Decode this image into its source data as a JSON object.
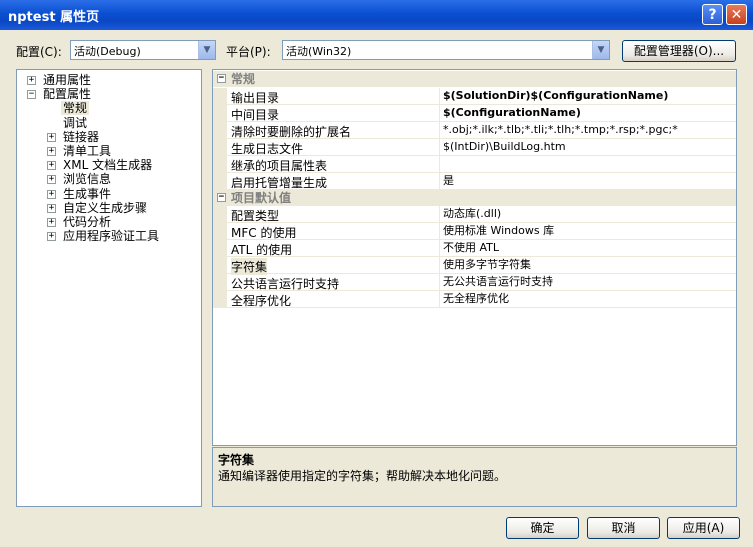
{
  "window": {
    "title": "nptest 属性页",
    "help_label": "?",
    "close_label": "✕"
  },
  "toolbar": {
    "config_label": "配置(C):",
    "config_value": "活动(Debug)",
    "platform_label": "平台(P):",
    "platform_value": "活动(Win32)",
    "config_manager_label": "配置管理器(O)..."
  },
  "tree": {
    "items": [
      {
        "label": "通用属性",
        "exp": "+"
      },
      {
        "label": "配置属性",
        "exp": "−"
      },
      {
        "label": "常规",
        "exp": ""
      },
      {
        "label": "调试",
        "exp": ""
      },
      {
        "label": "链接器",
        "exp": "+"
      },
      {
        "label": "清单工具",
        "exp": "+"
      },
      {
        "label": "XML 文档生成器",
        "exp": "+"
      },
      {
        "label": "浏览信息",
        "exp": "+"
      },
      {
        "label": "生成事件",
        "exp": "+"
      },
      {
        "label": "自定义生成步骤",
        "exp": "+"
      },
      {
        "label": "代码分析",
        "exp": "+"
      },
      {
        "label": "应用程序验证工具",
        "exp": "+"
      }
    ],
    "selected": "常规"
  },
  "grid": {
    "categories": [
      {
        "name": "常规",
        "exp": "−",
        "rows": [
          {
            "name": "输出目录",
            "value": "$(SolutionDir)$(ConfigurationName)",
            "bold": true
          },
          {
            "name": "中间目录",
            "value": "$(ConfigurationName)",
            "bold": true
          },
          {
            "name": "清除时要删除的扩展名",
            "value": "*.obj;*.ilk;*.tlb;*.tli;*.tlh;*.tmp;*.rsp;*.pgc;*",
            "bold": false
          },
          {
            "name": "生成日志文件",
            "value": "$(IntDir)\\BuildLog.htm",
            "bold": false
          },
          {
            "name": "继承的项目属性表",
            "value": "",
            "bold": false
          },
          {
            "name": "启用托管增量生成",
            "value": "是",
            "bold": false
          }
        ]
      },
      {
        "name": "项目默认值",
        "exp": "−",
        "rows": [
          {
            "name": "配置类型",
            "value": "动态库(.dll)",
            "bold": false
          },
          {
            "name": "MFC 的使用",
            "value": "使用标准 Windows 库",
            "bold": false
          },
          {
            "name": "ATL 的使用",
            "value": "不使用 ATL",
            "bold": false
          },
          {
            "name": "字符集",
            "value": "使用多字节字符集",
            "bold": false
          },
          {
            "name": "公共语言运行时支持",
            "value": "无公共语言运行时支持",
            "bold": false
          },
          {
            "name": "全程序优化",
            "value": "无全程序优化",
            "bold": false
          }
        ]
      }
    ],
    "selected_row": "字符集"
  },
  "description": {
    "title": "字符集",
    "text": "通知编译器使用指定的字符集；帮助解决本地化问题。"
  },
  "buttons": {
    "ok_label": "确定",
    "cancel_label": "取消",
    "apply_label": "应用(A)"
  }
}
